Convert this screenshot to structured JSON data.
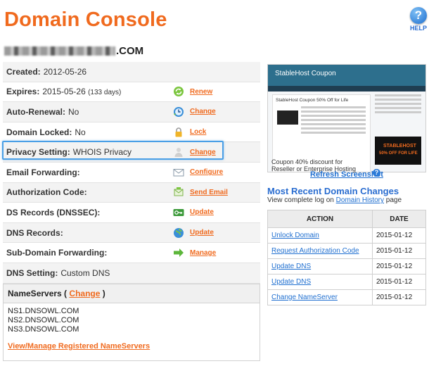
{
  "title": "Domain Console",
  "help": {
    "label": "HELP",
    "glyph": "?"
  },
  "domain": {
    "suffix": ".COM"
  },
  "rows": [
    {
      "label": "Created:",
      "value": "2012-05-26",
      "action": ""
    },
    {
      "label": "Expires:",
      "value": "2015-05-26",
      "note": "(133 days)",
      "action": "Renew",
      "icon": "renew-icon"
    },
    {
      "label": "Auto-Renewal:",
      "value": "No",
      "action": "Change",
      "icon": "clock-icon"
    },
    {
      "label": "Domain Locked:",
      "value": "No",
      "action": "Lock",
      "icon": "lock-icon"
    },
    {
      "label": "Privacy Setting:",
      "value": "WHOIS Privacy",
      "action": "Change",
      "icon": "privacy-user-icon"
    },
    {
      "label": "Email Forwarding:",
      "value": "",
      "action": "Configure",
      "icon": "envelope-icon"
    },
    {
      "label": "Authorization Code:",
      "value": "",
      "action": "Send Email",
      "icon": "mail-send-icon"
    },
    {
      "label": "DS Records (DNSSEC):",
      "value": "",
      "action": "Update",
      "icon": "key-icon"
    },
    {
      "label": "DNS Records:",
      "value": "",
      "action": "Update",
      "icon": "globe-icon"
    },
    {
      "label": "Sub-Domain Forwarding:",
      "value": "",
      "action": "Manage",
      "icon": "arrow-right-icon"
    },
    {
      "label": "DNS Setting:",
      "value": "Custom DNS",
      "action": ""
    }
  ],
  "nameservers": {
    "heading_pre": "NameServers (",
    "heading_link": "Change",
    "heading_post": ")",
    "list": [
      "NS1.DNSOWL.COM",
      "NS2.DNSOWL.COM",
      "NS3.DNSOWL.COM"
    ],
    "manage_link": "View/Manage Registered NameServers"
  },
  "screenshot": {
    "header": "StableHost Coupon",
    "post_title": "StableHost Coupon 50% Off for Life",
    "ad_brand": "STABLEHOST",
    "ad_offer": "50% OFF FOR LIFE",
    "caption": "Coupon 40% discount for Reseller or Enterprise Hosting",
    "refresh_label": "Refresh Screenshot"
  },
  "recent": {
    "title": "Most Recent Domain Changes",
    "sub_pre": "View complete log on",
    "sub_link": "Domain History",
    "sub_post": "page",
    "columns": [
      "ACTION",
      "DATE"
    ],
    "rows": [
      {
        "action": "Unlock Domain",
        "date": "2015-01-12"
      },
      {
        "action": "Request Authorization Code",
        "date": "2015-01-12"
      },
      {
        "action": "Update DNS",
        "date": "2015-01-12"
      },
      {
        "action": "Update DNS",
        "date": "2015-01-12"
      },
      {
        "action": "Change NameServer",
        "date": "2015-01-12"
      }
    ]
  },
  "colors": {
    "accent": "#f06a1e",
    "link": "#1f6fd0",
    "highlight": "#4a9fe6"
  }
}
